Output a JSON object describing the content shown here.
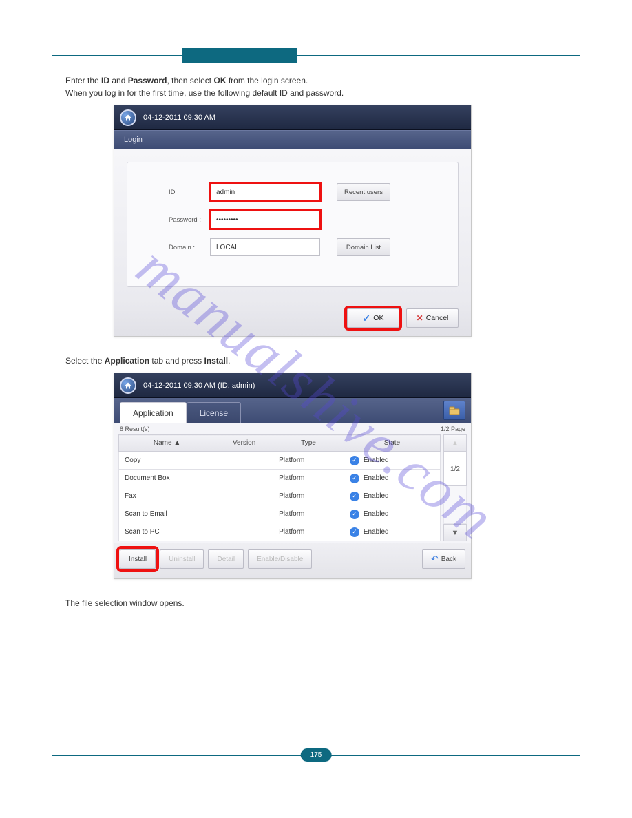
{
  "page_number": "175",
  "intro": {
    "line1_prefix": "Enter the ",
    "line1_bold1": "ID",
    "line1_mid": " and ",
    "line1_bold2": "Password",
    "line1_suffix": ", then select ",
    "line1_bold3": "OK",
    "line1_end": " from the login screen.",
    "line2": "When you log in for the first time, use the following default ID and password."
  },
  "login_panel": {
    "timestamp": "04-12-2011 09:30 AM",
    "header": "Login",
    "id_label": "ID :",
    "id_value": "admin",
    "pw_label": "Password :",
    "pw_value": "•••••••••",
    "domain_label": "Domain :",
    "domain_value": "LOCAL",
    "recent_users_btn": "Recent users",
    "domain_list_btn": "Domain List",
    "ok_btn": "OK",
    "cancel_btn": "Cancel"
  },
  "mid_text": {
    "prefix": "Select the ",
    "bold1": "Application",
    "mid": " tab and press ",
    "bold2": "Install",
    "end": "."
  },
  "app_panel": {
    "timestamp": "04-12-2011 09:30 AM (ID: admin)",
    "tabs": {
      "application": "Application",
      "license": "License"
    },
    "results": "8 Result(s)",
    "pager": "1/2  Page",
    "page_side": "1/2",
    "columns": {
      "name": "Name ▲",
      "version": "Version",
      "type": "Type",
      "state": "State"
    },
    "rows": [
      {
        "name": "Copy",
        "version": "",
        "type": "Platform",
        "state": "Enabled"
      },
      {
        "name": "Document Box",
        "version": "",
        "type": "Platform",
        "state": "Enabled"
      },
      {
        "name": "Fax",
        "version": "",
        "type": "Platform",
        "state": "Enabled"
      },
      {
        "name": "Scan to Email",
        "version": "",
        "type": "Platform",
        "state": "Enabled"
      },
      {
        "name": "Scan to PC",
        "version": "",
        "type": "Platform",
        "state": "Enabled"
      }
    ],
    "buttons": {
      "install": "Install",
      "uninstall": "Uninstall",
      "detail": "Detail",
      "enable_disable": "Enable/Disable",
      "back": "Back"
    }
  },
  "closing_text": "The file selection window opens.",
  "watermark": "manualshive.com"
}
